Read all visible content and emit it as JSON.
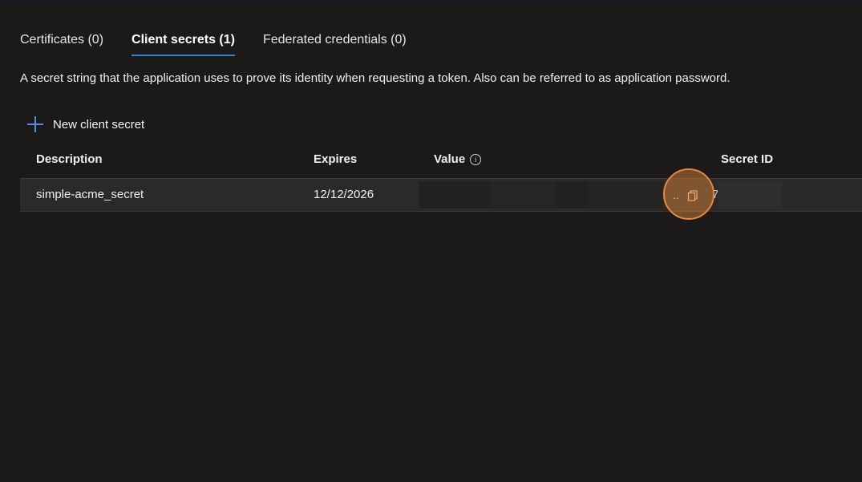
{
  "tabs": [
    {
      "label": "Certificates (0)",
      "active": false
    },
    {
      "label": "Client secrets (1)",
      "active": true
    },
    {
      "label": "Federated credentials (0)",
      "active": false
    }
  ],
  "description": "A secret string that the application uses to prove its identity when requesting a token. Also can be referred to as application password.",
  "toolbar": {
    "new_label": "New client secret",
    "new_icon": "plus-icon"
  },
  "table": {
    "headers": {
      "description": "Description",
      "expires": "Expires",
      "value": "Value",
      "secret_id": "Secret ID"
    },
    "value_info_icon": "info-icon",
    "rows": [
      {
        "description": "simple-acme_secret",
        "expires": "12/12/2026",
        "value_truncated": "..",
        "secret_id_fragment": "7"
      }
    ]
  },
  "colors": {
    "background": "#1b1a19",
    "accent": "#2f7ed8",
    "highlight": "#e8893a"
  }
}
